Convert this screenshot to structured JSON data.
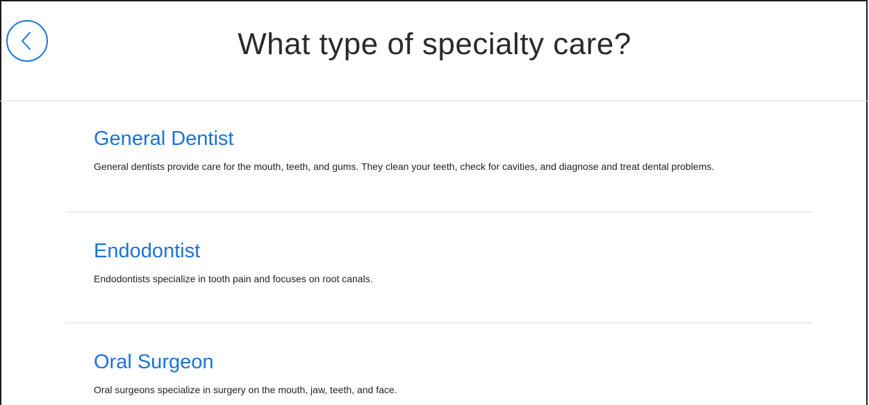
{
  "header": {
    "title": "What type of specialty care?",
    "back_icon": "chevron-left-icon"
  },
  "colors": {
    "accent": "#1a73d9",
    "text": "#222222",
    "divider": "#dcdcdc",
    "background": "#ffffff"
  },
  "specialties": [
    {
      "title": "General Dentist",
      "description": "General dentists provide care for the mouth, teeth, and gums. They clean your teeth, check for cavities, and diagnose and treat dental problems."
    },
    {
      "title": "Endodontist",
      "description": "Endodontists specialize in tooth pain and focuses on root canals."
    },
    {
      "title": "Oral Surgeon",
      "description": "Oral surgeons specialize in surgery on the mouth, jaw, teeth, and face."
    }
  ]
}
